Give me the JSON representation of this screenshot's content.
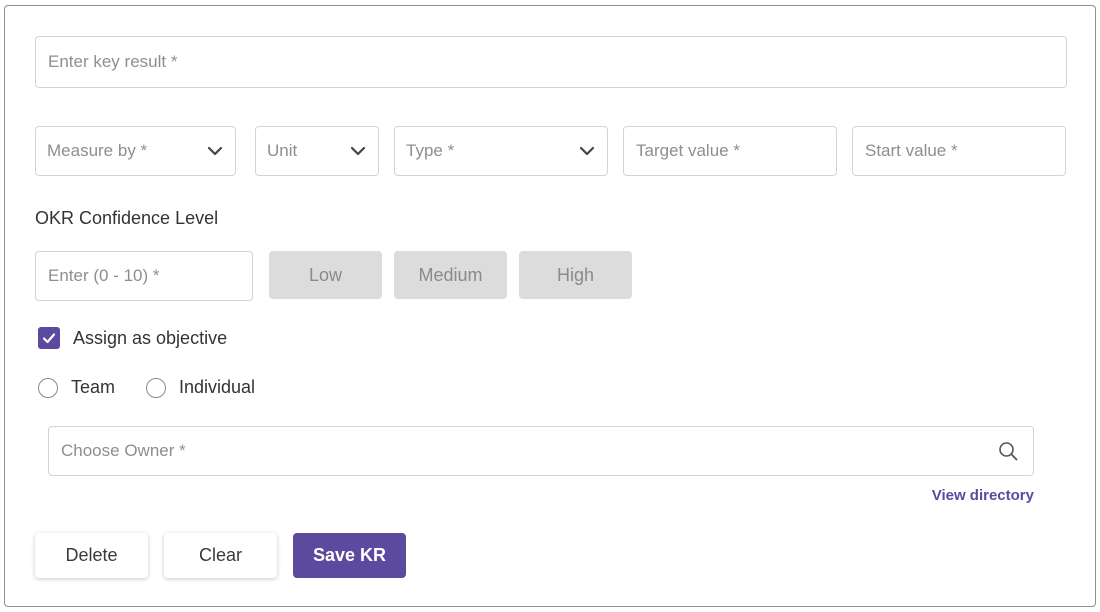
{
  "key_result": {
    "placeholder": "Enter key result *"
  },
  "measure_by": {
    "placeholder": "Measure by *",
    "icon": "chevron-down-icon"
  },
  "unit": {
    "placeholder": "Unit",
    "icon": "chevron-down-icon"
  },
  "type": {
    "placeholder": "Type *",
    "icon": "chevron-down-icon"
  },
  "target_value": {
    "placeholder": "Target value *"
  },
  "start_value": {
    "placeholder": "Start value *"
  },
  "confidence": {
    "label": "OKR Confidence Level",
    "input_placeholder": "Enter (0 - 10) *",
    "levels": [
      "Low",
      "Medium",
      "High"
    ]
  },
  "assign_objective": {
    "label": "Assign as objective",
    "checked": true
  },
  "assignee_type": {
    "options": [
      "Team",
      "Individual"
    ]
  },
  "owner": {
    "placeholder": "Choose Owner *",
    "icon": "search-icon"
  },
  "view_directory": "View directory",
  "actions": {
    "delete": "Delete",
    "clear": "Clear",
    "save": "Save KR"
  },
  "colors": {
    "accent": "#5c4a9e",
    "level_bg": "#dcdcdc",
    "border": "#d4d4d4"
  }
}
